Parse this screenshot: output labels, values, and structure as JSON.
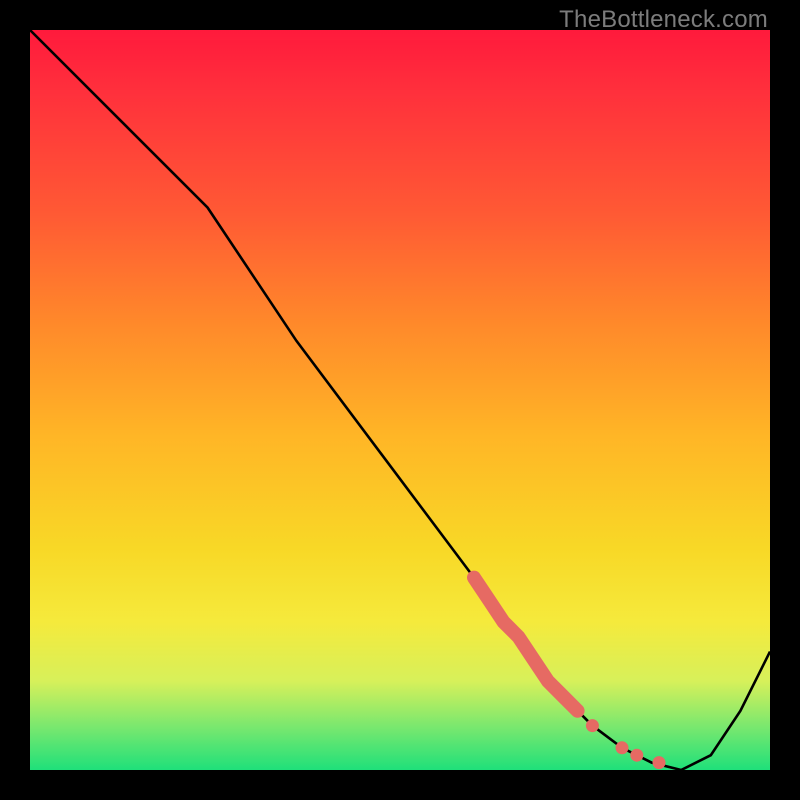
{
  "watermark": "TheBottleneck.com",
  "colors": {
    "line": "#000000",
    "marker_fill": "#e66a63",
    "marker_stroke": "#e66a63"
  },
  "chart_data": {
    "type": "line",
    "title": "",
    "xlabel": "",
    "ylabel": "",
    "xlim": [
      0,
      100
    ],
    "ylim": [
      0,
      100
    ],
    "x": [
      0,
      12,
      24,
      36,
      48,
      60,
      68,
      72,
      76,
      80,
      84,
      88,
      92,
      96,
      100
    ],
    "y": [
      100,
      88,
      76,
      58,
      42,
      26,
      15,
      10,
      6,
      3,
      1,
      0,
      2,
      8,
      16
    ],
    "highlight_segment": {
      "x": [
        60,
        62,
        64,
        66,
        68,
        70,
        72,
        74
      ],
      "y": [
        26,
        23,
        20,
        18,
        15,
        12,
        10,
        8
      ]
    },
    "markers": {
      "x": [
        76,
        80,
        82,
        85
      ],
      "y": [
        6,
        3,
        2,
        1
      ]
    },
    "annotations": []
  }
}
